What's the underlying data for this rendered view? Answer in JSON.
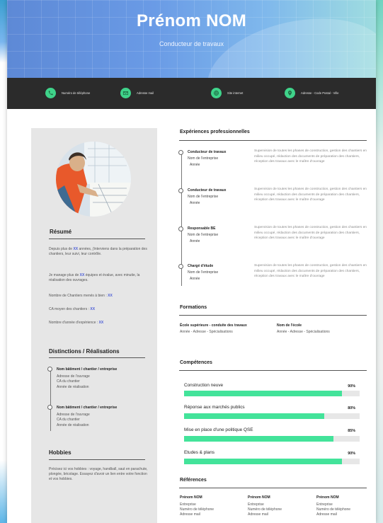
{
  "header": {
    "name": "Prénom NOM",
    "job_title": "Conducteur de travaux"
  },
  "contacts": [
    {
      "icon": "phone-icon",
      "label": "Numéro de téléphone"
    },
    {
      "icon": "email-icon",
      "label": "Adresse mail"
    },
    {
      "icon": "website-icon",
      "label": "Site internet"
    },
    {
      "icon": "location-icon",
      "label": "Adresse - Code Postal - Ville"
    }
  ],
  "colors": {
    "accent": "#3fd38a",
    "bar": "#43e39a",
    "highlight": "#4a5cd6",
    "dark_bar": "#2b2b2b"
  },
  "resume": {
    "title": "Résumé",
    "p1_a": "Depuis plus de ",
    "p1_hl": "XX",
    "p1_b": " années, j'interviens dans la préparation des chantiers, leur suivi, leur contrôle.",
    "p2_a": "Je manage plus de ",
    "p2_hl": "XX",
    "p2_b": " équipes et évalue, avec minutie, la réalisation des ouvrages.",
    "stat1_label": "Nombre de Chantiers menés à bien : ",
    "stat1_value": "XX",
    "stat2_label": "CA moyen des chantiers : ",
    "stat2_value": "XX",
    "stat3_label": "Nombre d'année d'expérience : ",
    "stat3_value": "XX"
  },
  "distinctions": {
    "title": "Distinctions / Réalisations",
    "items": [
      {
        "title": "Nom bâtiment / chantier / entreprise",
        "line1": "Adresse de l'ouvrage",
        "line2": "CA du chantier",
        "line3": "Année de réalisation"
      },
      {
        "title": "Nom bâtiment / chantier / entreprise",
        "line1": "Adresse de l'ouvrage",
        "line2": "CA du chantier",
        "line3": "Année de réalisation"
      }
    ]
  },
  "hobbies": {
    "title": "Hobbies",
    "text": "Précisez ici vos hobbies : voyage, handball, saut en parachute, plongée, bricolage. Essayez d'avoir un lien entre votre fonction et vos hobbies."
  },
  "experiences": {
    "title": "Expériences professionnelles",
    "items": [
      {
        "role": "Conducteur de travaux",
        "company": "Nom de l'entreprise",
        "year": "Année",
        "desc": "Supervision de toutes les phases de construction, gestion des chantiers en milieu occupé, rédaction des documents de préparation des chantiers, réception des travaux avec le maître d'ouvrage"
      },
      {
        "role": "Conducteur de travaux",
        "company": "Nom de l'entreprise",
        "year": "Année",
        "desc": "Supervision de toutes les phases de construction, gestion des chantiers en milieu occupé, rédaction des documents de préparation des chantiers, réception des travaux avec le maître d'ouvrage"
      },
      {
        "role": "Responsable BE",
        "company": "Nom de l'entreprise",
        "year": "Année",
        "desc": "Supervision de toutes les phases de construction, gestion des chantiers en milieu occupé, rédaction des documents de préparation des chantiers, réception des travaux avec le maître d'ouvrage"
      },
      {
        "role": "Chargé d'étude",
        "company": "Nom de l'entreprise",
        "year": "Année",
        "desc": "Supervision de toutes les phases de construction, gestion des chantiers en milieu occupé, rédaction des documents de préparation des chantiers, réception des travaux avec le maître d'ouvrage"
      }
    ]
  },
  "formations": {
    "title": "Formations",
    "items": [
      {
        "title": "École supérieure - conduite des travaux",
        "sub": "Année - Adresse - Spécialisations"
      },
      {
        "title": "Nom de l'école",
        "sub": "Année - Adresse - Spécialisations"
      }
    ]
  },
  "competences": {
    "title": "Compétences",
    "items": [
      {
        "name": "Construction neuve",
        "pct_label": "90%",
        "level": 0.9
      },
      {
        "name": "Réponse aux marchés publics",
        "pct_label": "80%",
        "level": 0.8
      },
      {
        "name": "Mise en place d'une politique QSE",
        "pct_label": "85%",
        "level": 0.85
      },
      {
        "name": "Etudes & plans",
        "pct_label": "90%",
        "level": 0.9
      }
    ]
  },
  "references": {
    "title": "Références",
    "items": [
      {
        "name": "Prénom NOM",
        "company": "Entreprise",
        "phone": "Numéro de téléphone",
        "email": "Adresse mail"
      },
      {
        "name": "Prénom NOM",
        "company": "Entreprise",
        "phone": "Numéro de téléphone",
        "email": "Adresse mail"
      },
      {
        "name": "Prénom NOM",
        "company": "Entreprise",
        "phone": "Numéro de téléphone",
        "email": "Adresse mail"
      }
    ]
  }
}
